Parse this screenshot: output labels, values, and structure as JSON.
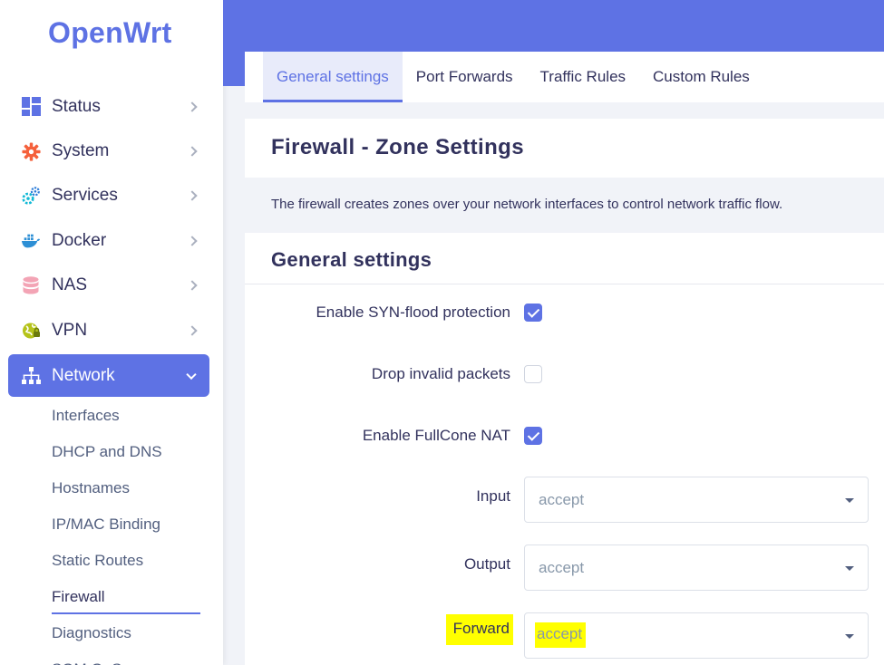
{
  "app": {
    "logo": "OpenWrt"
  },
  "sidebar": {
    "items": [
      {
        "label": "Status",
        "icon": "dashboard-icon"
      },
      {
        "label": "System",
        "icon": "gear-icon"
      },
      {
        "label": "Services",
        "icon": "cogs-icon"
      },
      {
        "label": "Docker",
        "icon": "docker-icon"
      },
      {
        "label": "NAS",
        "icon": "database-icon"
      },
      {
        "label": "VPN",
        "icon": "vpn-globe-icon"
      },
      {
        "label": "Network",
        "icon": "network-tree-icon"
      }
    ],
    "submenu": [
      "Interfaces",
      "DHCP and DNS",
      "Hostnames",
      "IP/MAC Binding",
      "Static Routes",
      "Firewall",
      "Diagnostics",
      "SQM QoS"
    ]
  },
  "tabs": [
    "General settings",
    "Port Forwards",
    "Traffic Rules",
    "Custom Rules"
  ],
  "page": {
    "title": "Firewall - Zone Settings",
    "description": "The firewall creates zones over your network interfaces to control network traffic flow."
  },
  "general": {
    "heading": "General settings",
    "syn_flood": {
      "label": "Enable SYN-flood protection",
      "checked": true
    },
    "drop_invalid": {
      "label": "Drop invalid packets",
      "checked": false
    },
    "fullcone": {
      "label": "Enable FullCone NAT",
      "checked": true
    },
    "input": {
      "label": "Input",
      "value": "accept"
    },
    "output": {
      "label": "Output",
      "value": "accept"
    },
    "forward": {
      "label": "Forward",
      "value": "accept"
    }
  },
  "colors": {
    "accent": "#5e72e4",
    "highlight": "#ffff00"
  }
}
